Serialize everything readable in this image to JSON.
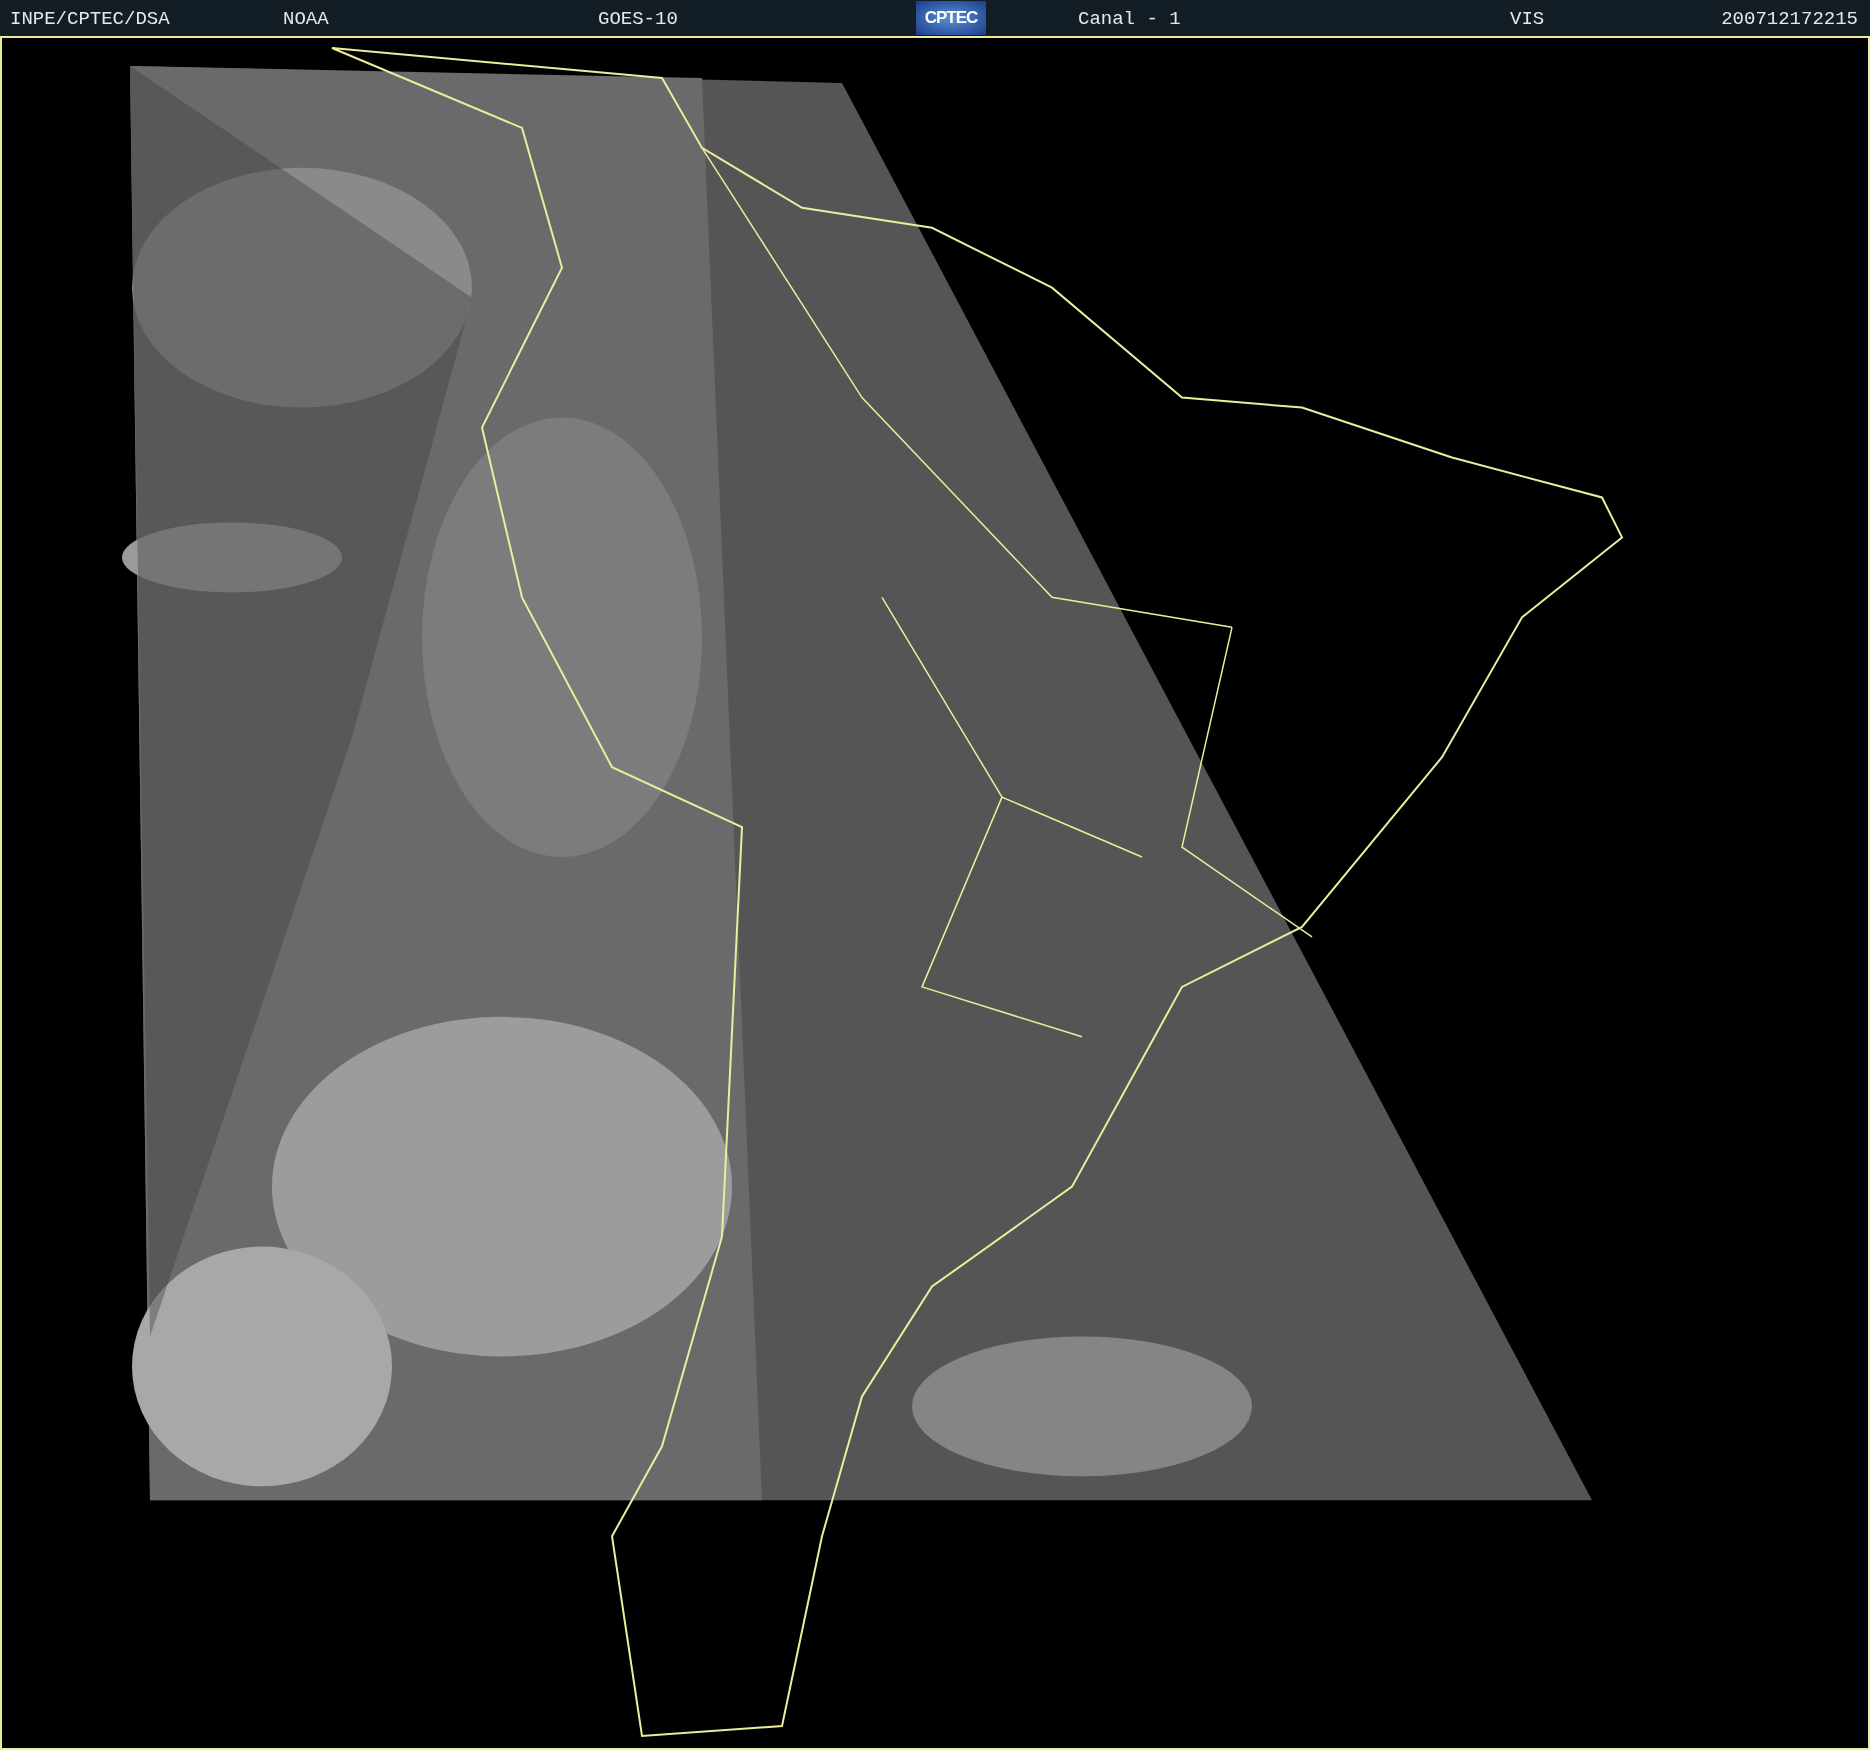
{
  "header": {
    "items": [
      "INPE/CPTEC/DSA",
      "NOAA",
      "GOES-10"
    ],
    "logo": "CPTEC",
    "channel": "Canal - 1",
    "band": "VIS",
    "timestamp": "200712172215"
  }
}
